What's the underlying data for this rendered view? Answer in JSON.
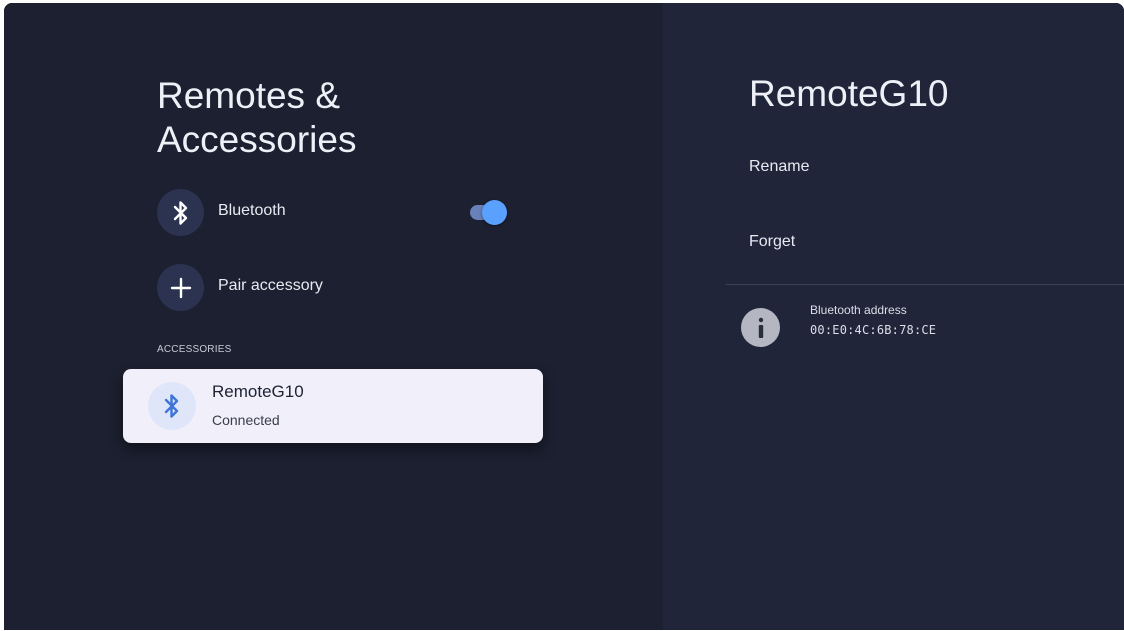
{
  "left": {
    "title": "Remotes & Accessories",
    "bluetooth": {
      "label": "Bluetooth",
      "icon": "bluetooth-icon",
      "enabled": true
    },
    "pair": {
      "label": "Pair accessory",
      "icon": "plus-icon"
    },
    "accessories_header": "ACCESSORIES",
    "accessories": [
      {
        "name": "RemoteG10",
        "status": "Connected",
        "icon": "bluetooth-icon"
      }
    ]
  },
  "right": {
    "title": "RemoteG10",
    "rename_label": "Rename",
    "forget_label": "Forget",
    "address_label": "Bluetooth address",
    "address_value": "00:E0:4C:6B:78:CE",
    "info_icon": "info-icon"
  },
  "colors": {
    "background_left": "#1c2030",
    "background_right": "#20253a",
    "toggle_accent": "#5aa0ff",
    "card_background": "#f0effa",
    "bluetooth_card_icon": "#3f74d8"
  }
}
